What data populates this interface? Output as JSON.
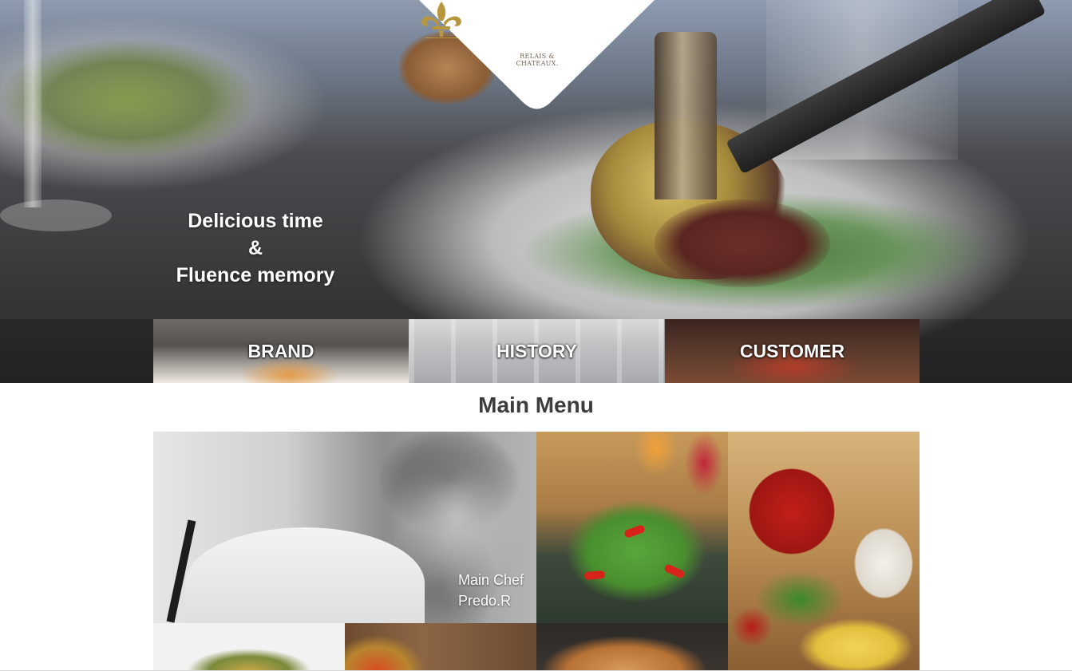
{
  "brand": {
    "logo_text_line1": "RELAIS &",
    "logo_text_line2": "CHATEAUX.",
    "logo_icon": "fleur-de-lis-icon",
    "accent_color": "#b8963e"
  },
  "hero": {
    "tagline_line1": "Delicious time",
    "tagline_line2": "&",
    "tagline_line3": "Fluence memory"
  },
  "categories": [
    {
      "label": "BRAND"
    },
    {
      "label": "HISTORY"
    },
    {
      "label": "CUSTOMER"
    }
  ],
  "main_menu": {
    "title": "Main Menu",
    "chef_caption_line1": "Main Chef",
    "chef_caption_line2": "Predo.R"
  }
}
